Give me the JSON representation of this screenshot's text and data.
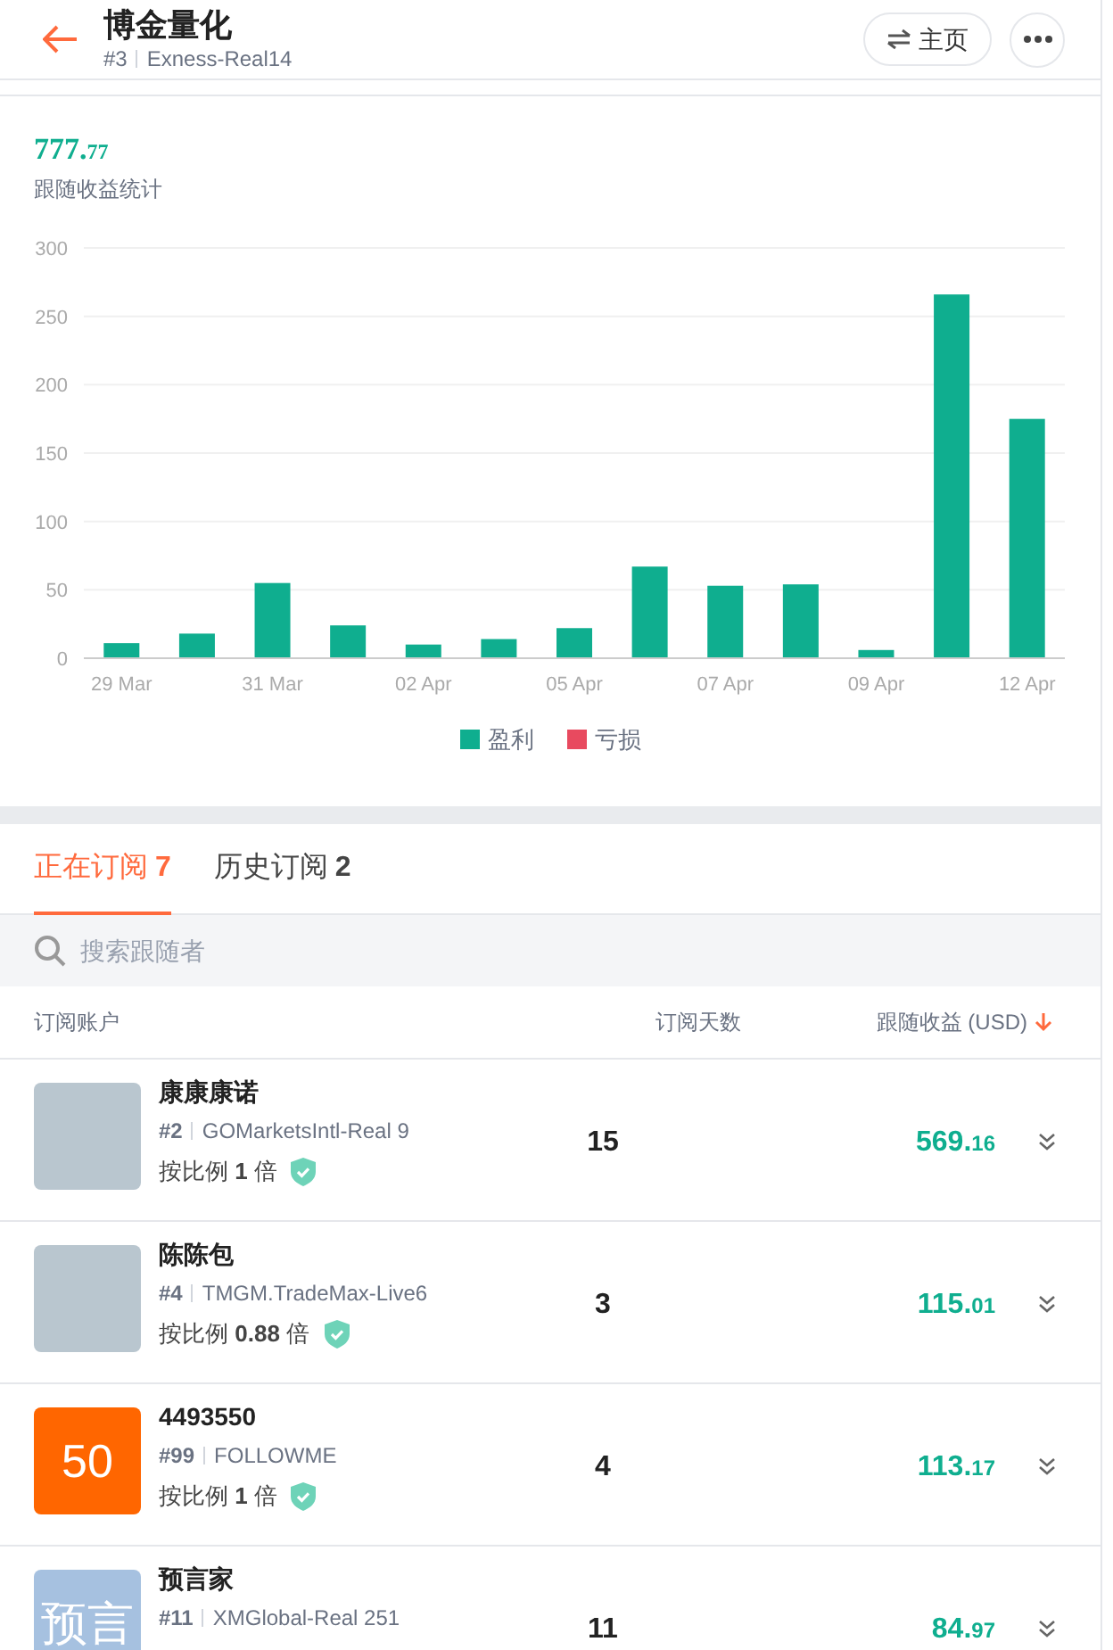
{
  "header": {
    "title": "博金量化",
    "rank": "#3",
    "account": "Exness-Real14",
    "home_button": "主页"
  },
  "summary": {
    "amount_main": "777.",
    "amount_fraction": "77",
    "label": "跟随收益统计"
  },
  "chart_data": {
    "type": "bar",
    "categories": [
      "29 Mar",
      null,
      "31 Mar",
      null,
      "02 Apr",
      null,
      "05 Apr",
      null,
      "07 Apr",
      null,
      "09 Apr",
      null,
      "12 Apr"
    ],
    "series": [
      {
        "name": "盈利",
        "color": "#0fae8f",
        "values": [
          11,
          18,
          55,
          24,
          10,
          14,
          22,
          67,
          53,
          54,
          6,
          266,
          175
        ]
      },
      {
        "name": "亏损",
        "color": "#e84a5f",
        "values": [
          null,
          null,
          null,
          null,
          null,
          null,
          null,
          null,
          null,
          null,
          null,
          null,
          null
        ]
      }
    ],
    "ylim": [
      0,
      300
    ],
    "yticks": [
      0,
      50,
      100,
      150,
      200,
      250,
      300
    ],
    "grid": true
  },
  "tabs": [
    {
      "label": "正在订阅",
      "count": "7",
      "selected": true
    },
    {
      "label": "历史订阅",
      "count": "2",
      "selected": false
    }
  ],
  "search": {
    "placeholder": "搜索跟随者"
  },
  "table": {
    "columns": [
      "订阅账户",
      "订阅天数",
      "跟随收益 (USD)"
    ],
    "rows": [
      {
        "avatar": {
          "kind": "photo"
        },
        "name": "康康康诺",
        "rank": "#2",
        "account": "GOMarketsIntl-Real 9",
        "ratio": "按比例 **1** 倍",
        "days": "15",
        "profit_main": "569.",
        "profit_fraction": "16"
      },
      {
        "avatar": {
          "kind": "photo"
        },
        "name": "陈陈包",
        "rank": "#4",
        "account": "TMGM.TradeMax-Live6",
        "ratio": "按比例 **0.88** 倍",
        "days": "3",
        "profit_main": "115.",
        "profit_fraction": "01"
      },
      {
        "avatar": {
          "kind": "text",
          "text": "50",
          "color": "#ff6600"
        },
        "name": "4493550",
        "rank": "#99",
        "account": "FOLLOWME",
        "ratio": "按比例 **1** 倍",
        "days": "4",
        "profit_main": "113.",
        "profit_fraction": "17"
      },
      {
        "avatar": {
          "kind": "text",
          "text": "预言",
          "color": "#a6c1e0"
        },
        "name": "预言家",
        "rank": "#11",
        "account": "XMGlobal-Real 251",
        "days": "11",
        "profit_main": "84.",
        "profit_fraction": "97"
      }
    ]
  }
}
